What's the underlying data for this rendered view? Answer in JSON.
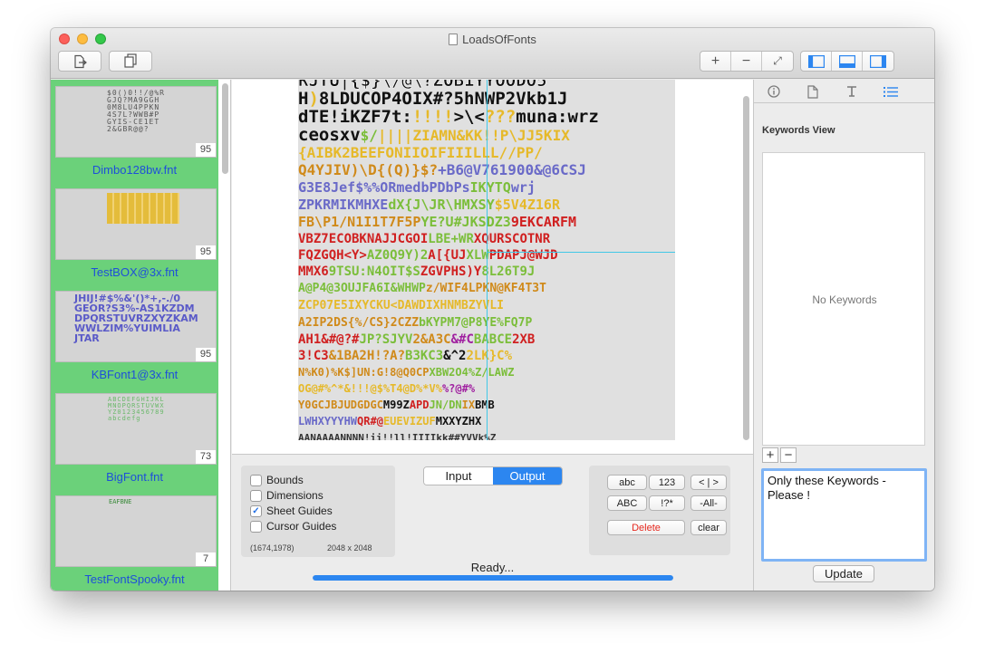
{
  "window": {
    "title": "LoadsOfFonts"
  },
  "toolbar": {
    "left_buttons": [
      "export-icon",
      "duplicate-icon"
    ],
    "zoom_buttons": [
      "+",
      "−",
      "⤢"
    ],
    "layout_buttons": [
      "sidebar-left-icon",
      "bottom-panel-icon",
      "sidebar-right-icon"
    ]
  },
  "fonts": [
    {
      "name": "Dimbo128bw.fnt",
      "count": "95"
    },
    {
      "name": "TestBOX@3x.fnt",
      "count": "95"
    },
    {
      "name": "KBFont1@3x.fnt",
      "count": "95"
    },
    {
      "name": "BigFont.fnt",
      "count": "73"
    },
    {
      "name": "TestFontSpooky.fnt",
      "count": "7"
    }
  ],
  "options": {
    "bounds": {
      "label": "Bounds",
      "checked": false
    },
    "dimensions": {
      "label": "Dimensions",
      "checked": false
    },
    "sheet_guides": {
      "label": "Sheet Guides",
      "checked": true
    },
    "cursor_guides": {
      "label": "Cursor Guides",
      "checked": false
    },
    "cursor_position": "(1674,1978)",
    "sheet_size": "2048 x 2048"
  },
  "mode": {
    "input": "Input",
    "output": "Output",
    "selected": "Output"
  },
  "keyword_buttons": {
    "abc": "abc",
    "num": "123",
    "brackets": "< | >",
    "ABC": "ABC",
    "symbols": "!?*",
    "all": "-All-",
    "delete": "Delete",
    "clear": "clear"
  },
  "status": {
    "text": "Ready...",
    "progress": 1.0
  },
  "inspector": {
    "tabs": [
      "info-icon",
      "file-icon",
      "text-format-icon",
      "list-icon"
    ],
    "active_tab": 3,
    "title": "Keywords View",
    "empty_text": "No Keywords",
    "keywords_text": "Only these Keywords - Please !",
    "update_label": "Update"
  },
  "colors": {
    "sidebar_selected": "#6bd17a",
    "accent": "#2c86f0",
    "delete": "#e6281e",
    "link": "#1e4fd9"
  }
}
